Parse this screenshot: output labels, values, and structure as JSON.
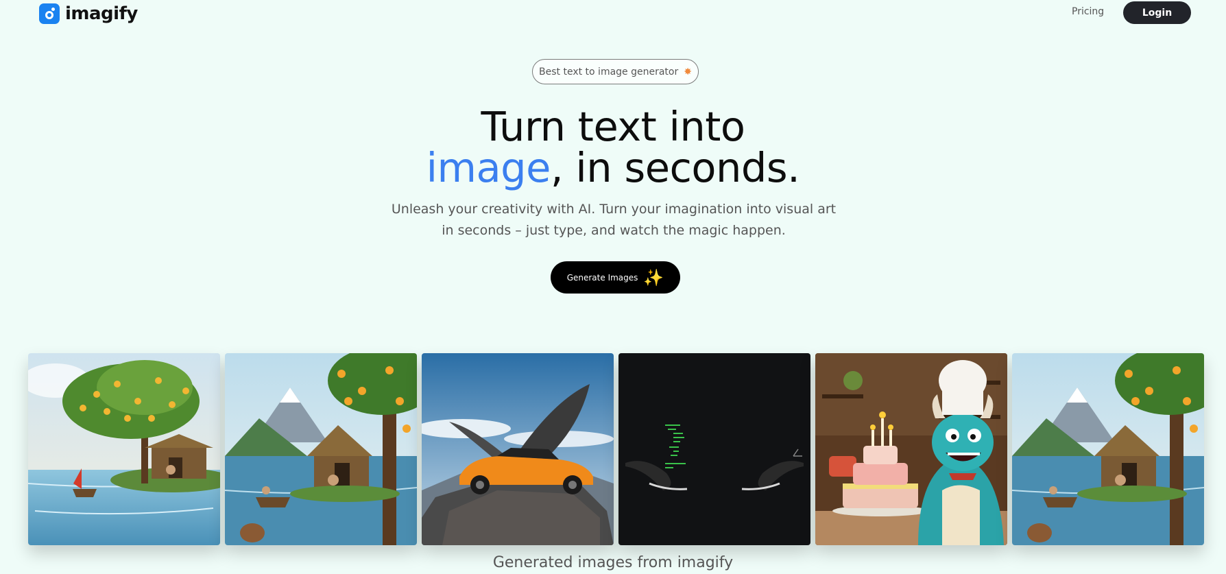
{
  "nav": {
    "brand": "imagify",
    "pricing_label": "Pricing",
    "login_label": "Login"
  },
  "hero": {
    "badge_text": "Best text to image generator",
    "badge_icon": "star-icon",
    "headline_line1": "Turn text into",
    "headline_accent": "image",
    "headline_rest": ", in seconds.",
    "subtitle": "Unleash your creativity with AI. Turn your imagination into visual art in seconds – just type, and watch the magic happen.",
    "cta_label": "Generate Images",
    "cta_icon": "sparkle-icon"
  },
  "gallery": {
    "images": [
      {
        "name": "mango-tree-boat-image"
      },
      {
        "name": "lakeside-hut-mountain-image"
      },
      {
        "name": "winged-sports-car-image"
      },
      {
        "name": "dark-code-scene-image"
      },
      {
        "name": "monster-chef-cake-image"
      },
      {
        "name": "lakeside-hut-mountain-image-2"
      }
    ],
    "caption": "Generated images from imagify"
  },
  "colors": {
    "background": "#effcf8",
    "accent": "#3b7fef",
    "button_dark": "#22242a",
    "logo_blue": "#1a82f0"
  }
}
